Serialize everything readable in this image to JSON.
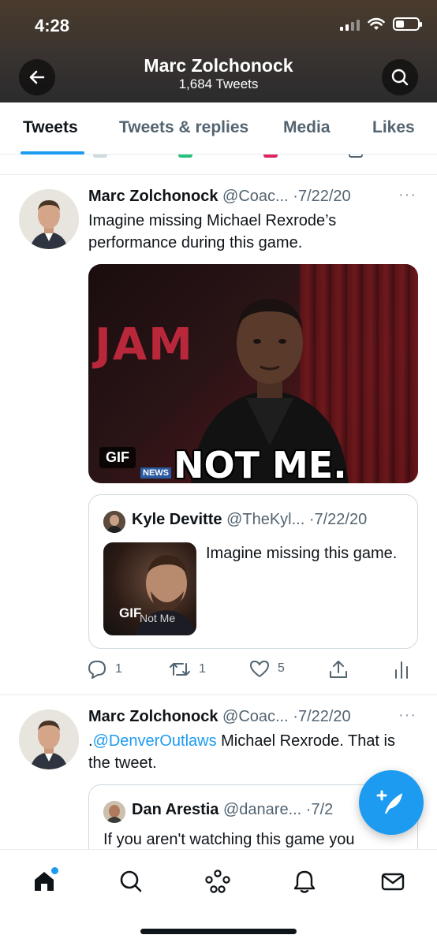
{
  "status_bar": {
    "time": "4:28"
  },
  "header": {
    "title": "Marc Zolchonock",
    "subtitle": "1,684 Tweets"
  },
  "tabs": [
    {
      "label": "Tweets",
      "active": true
    },
    {
      "label": "Tweets & replies",
      "active": false
    },
    {
      "label": "Media",
      "active": false
    },
    {
      "label": "Likes",
      "active": false
    }
  ],
  "tweets": [
    {
      "name": "Marc Zolchonock",
      "handle": "@Coac...",
      "date": "·7/22/20",
      "more": "···",
      "text": "Imagine missing Michael Rexrode’s performance during this game.",
      "media": {
        "badge": "GIF",
        "caption": "NOT ME.",
        "bg_text": "JAM",
        "logo_text": "NEWS"
      },
      "quote": {
        "name": "Kyle Devitte",
        "handle": "@TheKyl...",
        "date": "·7/22/20",
        "text": "Imagine missing this game.",
        "badge": "GIF",
        "thumb_text": "Not Me"
      },
      "actions": {
        "replies": "1",
        "retweets": "1",
        "likes": "5"
      }
    },
    {
      "name": "Marc Zolchonock",
      "handle": "@Coac...",
      "date": "·7/22/20",
      "more": "···",
      "text_prefix": ".",
      "mention": "@DenverOutlaws",
      "text_suffix": " Michael Rexrode. That is the tweet.",
      "quote": {
        "name": "Dan Arestia",
        "handle": "@danare...",
        "date": "·7/2",
        "text": "If you aren't watching this game you"
      }
    }
  ],
  "colors": {
    "accent": "#1d9bf0",
    "text": "#0f1419",
    "secondary": "#536471"
  }
}
